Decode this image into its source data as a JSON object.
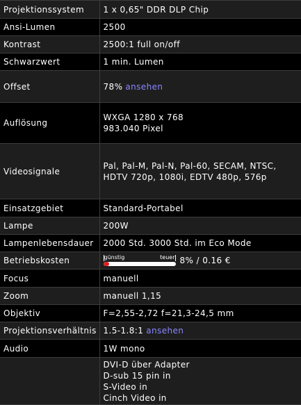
{
  "rows": [
    {
      "label": "Projektionssystem",
      "lines": [
        "1 x 0,65\" DDR DLP Chip"
      ]
    },
    {
      "label": "Ansi-Lumen",
      "lines": [
        "2500"
      ]
    },
    {
      "label": "Kontrast",
      "lines": [
        "2500:1 full on/off"
      ]
    },
    {
      "label": "Schwarzwert",
      "lines": [
        "1 min. Lumen"
      ]
    },
    {
      "label": "Offset",
      "lines": [
        "78%"
      ],
      "link": "ansehen"
    },
    {
      "label": "Auflösung",
      "lines": [
        "WXGA 1280 x 768",
        "983.040 Pixel"
      ]
    },
    {
      "label": "Videosignale",
      "lines": [
        "Pal, Pal-M, Pal-N, Pal-60, SECAM, NTSC, HDTV 720p, 1080i, EDTV 480p, 576p"
      ]
    },
    {
      "label": "Einsatzgebiet",
      "lines": [
        "Standard-Portabel"
      ]
    },
    {
      "label": "Lampe",
      "lines": [
        "200W"
      ]
    },
    {
      "label": "Lampenlebensdauer",
      "lines": [
        "2000 Std. 3000 Std. im Eco Mode"
      ]
    },
    {
      "label": "Betriebskosten",
      "cost": {
        "low_label": "günstig",
        "high_label": "teuer",
        "level": 0.08,
        "value": "8% / 0.16 €"
      }
    },
    {
      "label": "Focus",
      "lines": [
        "manuell"
      ]
    },
    {
      "label": "Zoom",
      "lines": [
        "manuell 1,15"
      ]
    },
    {
      "label": "Objektiv",
      "lines": [
        "F=2,55-2,72 f=21,3-24,5 mm"
      ]
    },
    {
      "label": "Projektionsverhältnis",
      "lines": [
        "1.5-1.8:1"
      ],
      "link": "ansehen"
    },
    {
      "label": "Audio",
      "lines": [
        "1W mono"
      ]
    },
    {
      "label": "",
      "lines": [
        "DVI-D über Adapter",
        "D-sub 15 pin in",
        "S-Video in",
        "Cinch Video in"
      ]
    }
  ],
  "colors": {
    "background": "#000000",
    "row_alt": "#1e1e1e",
    "text": "#ffffff",
    "link": "#8a86ff",
    "cost_fill": "#e02020"
  }
}
